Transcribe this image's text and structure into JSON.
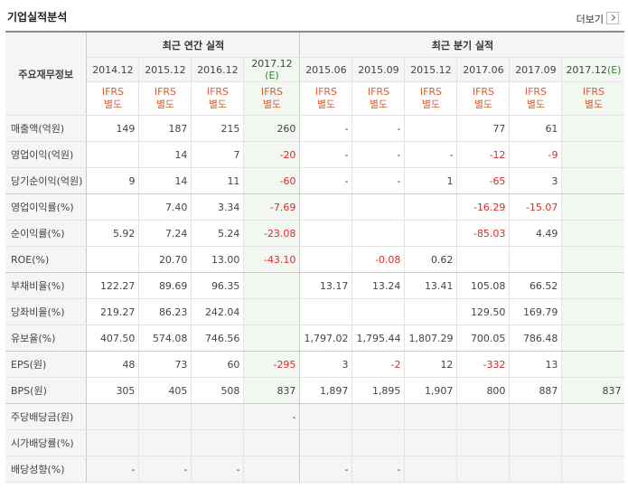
{
  "title": "기업실적분석",
  "more_label": "더보기",
  "header": {
    "row_label": "주요재무정보",
    "annual_group": "최근 연간 실적",
    "quarter_group": "최근 분기 실적",
    "periods": [
      "2014.12",
      "2015.12",
      "2016.12",
      "2017.12",
      "2015.06",
      "2015.09",
      "2015.12",
      "2017.06",
      "2017.09",
      "2017.12"
    ],
    "estimate_marker": "(E)",
    "ifrs_line1": "IFRS",
    "ifrs_line2": "별도"
  },
  "rows": [
    {
      "label": "매출액(억원)",
      "values": [
        "149",
        "187",
        "215",
        "260",
        "-",
        "-",
        "",
        "77",
        "61",
        ""
      ]
    },
    {
      "label": "영업이익(억원)",
      "values": [
        "",
        "14",
        "7",
        "-20",
        "-",
        "-",
        "-",
        "-12",
        "-9",
        ""
      ]
    },
    {
      "label": "당기순이익(억원)",
      "values": [
        "9",
        "14",
        "11",
        "-60",
        "-",
        "-",
        "1",
        "-65",
        "3",
        ""
      ]
    },
    {
      "label": "영업이익률(%)",
      "values": [
        "",
        "7.40",
        "3.34",
        "-7.69",
        "",
        "",
        "",
        "-16.29",
        "-15.07",
        ""
      ]
    },
    {
      "label": "순이익률(%)",
      "values": [
        "5.92",
        "7.24",
        "5.24",
        "-23.08",
        "",
        "",
        "",
        "-85.03",
        "4.49",
        ""
      ]
    },
    {
      "label": "ROE(%)",
      "values": [
        "",
        "20.70",
        "13.00",
        "-43.10",
        "",
        "-0.08",
        "0.62",
        "",
        "",
        ""
      ]
    },
    {
      "label": "부채비율(%)",
      "values": [
        "122.27",
        "89.69",
        "96.35",
        "",
        "13.17",
        "13.24",
        "13.41",
        "105.08",
        "66.52",
        ""
      ]
    },
    {
      "label": "당좌비율(%)",
      "values": [
        "219.27",
        "86.23",
        "242.04",
        "",
        "",
        "",
        "",
        "129.50",
        "169.79",
        ""
      ]
    },
    {
      "label": "유보율(%)",
      "values": [
        "407.50",
        "574.08",
        "746.56",
        "",
        "1,797.02",
        "1,795.44",
        "1,807.29",
        "700.05",
        "786.48",
        ""
      ]
    },
    {
      "label": "EPS(원)",
      "values": [
        "48",
        "73",
        "60",
        "-295",
        "3",
        "-2",
        "12",
        "-332",
        "13",
        ""
      ]
    },
    {
      "label": "BPS(원)",
      "values": [
        "305",
        "405",
        "508",
        "837",
        "1,897",
        "1,895",
        "1,907",
        "800",
        "887",
        "837"
      ]
    },
    {
      "label": "주당배당금(원)",
      "values": [
        "",
        "",
        "",
        "-",
        "",
        "",
        "",
        "",
        "",
        ""
      ]
    },
    {
      "label": "시가배당률(%)",
      "values": [
        "",
        "",
        "",
        "",
        "",
        "",
        "",
        "",
        "",
        ""
      ]
    },
    {
      "label": "배당성향(%)",
      "values": [
        "-",
        "-",
        "-",
        "",
        "-",
        "-",
        "",
        "",
        "",
        ""
      ]
    }
  ],
  "colors": {
    "negative": "#e02a2a",
    "ifrs": "#e05a2a",
    "estimate_bg": "#f2f7f2",
    "header_bg": "#f5f5f5"
  }
}
